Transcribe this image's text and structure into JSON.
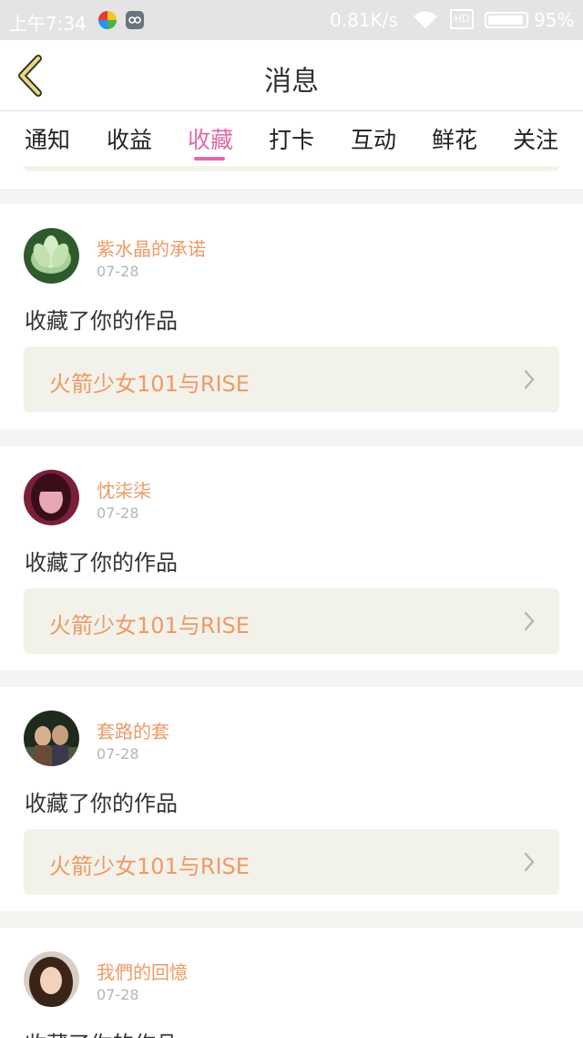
{
  "status_bar": {
    "time": "上午7:34",
    "network_speed": "0.81K/s",
    "sim": "HD",
    "battery": "95%"
  },
  "header": {
    "title": "消息"
  },
  "tabs": [
    {
      "label": "通知",
      "active": false
    },
    {
      "label": "收益",
      "active": false
    },
    {
      "label": "收藏",
      "active": true
    },
    {
      "label": "打卡",
      "active": false
    },
    {
      "label": "互动",
      "active": false
    },
    {
      "label": "鲜花",
      "active": false
    },
    {
      "label": "关注",
      "active": false
    }
  ],
  "colors": {
    "accent": "#e26aa8",
    "name_color": "#ee9a65",
    "work_box_bg": "#f3f2ea",
    "page_bg": "#f4f4f2"
  },
  "notifications": [
    {
      "user": "紫水晶的承诺",
      "date": "07-28",
      "action": "收藏了你的作品",
      "work": "火箭少女101与RISE",
      "avatar": "lotus-flower-avatar"
    },
    {
      "user": "忱柒柒",
      "date": "07-28",
      "action": "收藏了你的作品",
      "work": "火箭少女101与RISE",
      "avatar": "girl-portrait-avatar"
    },
    {
      "user": "套路的套",
      "date": "07-28",
      "action": "收藏了你的作品",
      "work": "火箭少女101与RISE",
      "avatar": "couple-photo-avatar"
    },
    {
      "user": "我們的回憶",
      "date": "07-28",
      "action": "收藏了你的作品",
      "work": "",
      "avatar": "woman-portrait-avatar"
    }
  ]
}
